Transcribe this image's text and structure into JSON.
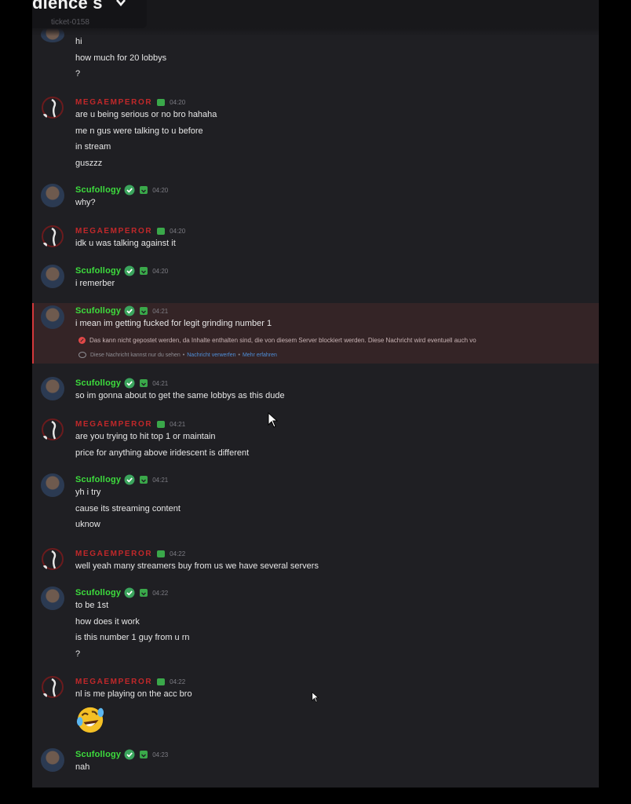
{
  "header": {
    "title": "dience s",
    "channel": "ticket-0158"
  },
  "users": {
    "mega": "MEGAEMPEROR",
    "scu": "Scufollogy"
  },
  "messages": [
    {
      "lines": [
        "hi",
        "how much for 20 lobbys",
        "?"
      ]
    },
    {
      "time": "04:20",
      "lines": [
        "are u being serious or no bro hahaha",
        "me n gus were talking to u before",
        "in stream",
        "guszzz"
      ]
    },
    {
      "time": "04:20",
      "lines": [
        "why?"
      ]
    },
    {
      "time": "04:20",
      "lines": [
        "idk u was talking against it"
      ]
    },
    {
      "time": "04:20",
      "lines": [
        "i remerber"
      ]
    },
    {
      "time": "04:21",
      "lines": [
        "i mean im getting fucked for legit grinding number 1"
      ]
    },
    {
      "time": "04:21",
      "lines": [
        "so im gonna about to get the same lobbys as this dude"
      ]
    },
    {
      "time": "04:21",
      "lines": [
        "are you trying to hit top 1 or maintain",
        "price for anything above iridescent is different"
      ]
    },
    {
      "time": "04:21",
      "lines": [
        "yh i try",
        "cause its streaming content",
        "uknow"
      ]
    },
    {
      "time": "04:22",
      "lines": [
        "well yeah many streamers buy from us we have several servers"
      ]
    },
    {
      "time": "04:22",
      "lines": [
        "to be 1st",
        "how does it work",
        "is this number 1 guy from u rn",
        "?"
      ]
    },
    {
      "time": "04:22",
      "lines": [
        "nl is me playing on the acc bro"
      ]
    },
    {
      "time": "04:23",
      "lines": [
        "nah"
      ]
    }
  ],
  "blocked": {
    "warning": "Das kann nicht gepostet werden, da Inhalte enthalten sind, die von diesem Server blockiert werden. Diese Nachricht wird eventuell auch vo",
    "note": "Diese Nachricht kannst nur du sehen",
    "separator": "•",
    "link1": "Nachricht verwerfen",
    "link2": "Mehr erfahren"
  },
  "icons": {
    "verified": "verified-check-icon",
    "role": "role-badge-icon",
    "emoji": "rolling-laughing-emoji",
    "cursor": "mouse-cursor"
  },
  "colors": {
    "background": "#1f1f23",
    "scu_name": "#3ddc3d",
    "mega_name": "#c0282a",
    "blocked_bg": "#342426",
    "link": "#4e8ed8"
  }
}
